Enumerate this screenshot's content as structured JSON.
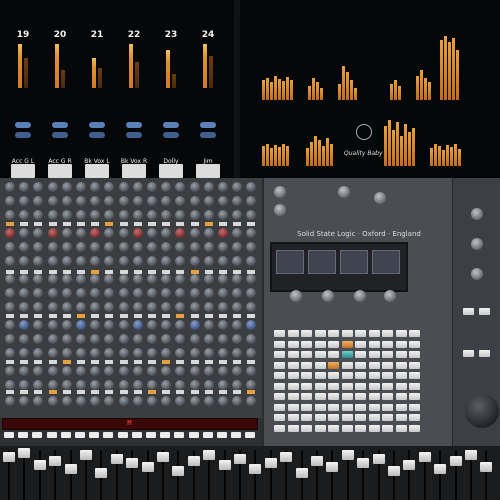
{
  "monitor_left": {
    "channels": [
      {
        "number": "19",
        "name": "Acc G L"
      },
      {
        "number": "20",
        "name": "Acc G R"
      },
      {
        "number": "21",
        "name": "Bk Vox L"
      },
      {
        "number": "22",
        "name": "Bk Vox R"
      },
      {
        "number": "23",
        "name": "Dolly"
      },
      {
        "number": "24",
        "name": "Jim"
      }
    ]
  },
  "monitor_right": {
    "logo_text": "Quality Baby"
  },
  "console": {
    "brand_text": "Solid State Logic · Oxford · England",
    "display_text": "M"
  },
  "colors": {
    "meter": "#e0902e",
    "display_red": "#ff4a3a",
    "accent_blue": "#5a82b8"
  }
}
